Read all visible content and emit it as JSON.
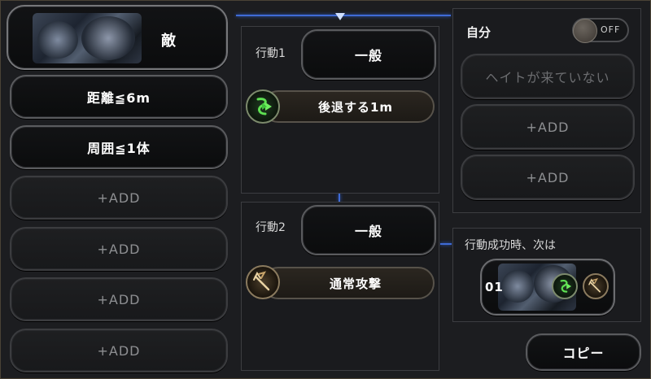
{
  "left_column": {
    "target_label": "敵",
    "conditions": [
      {
        "label": "距離≦6m",
        "state": "set"
      },
      {
        "label": "周囲≦1体",
        "state": "set"
      },
      {
        "label": "+ADD",
        "state": "add"
      },
      {
        "label": "+ADD",
        "state": "add"
      },
      {
        "label": "+ADD",
        "state": "add"
      },
      {
        "label": "+ADD",
        "state": "add"
      }
    ]
  },
  "actions": [
    {
      "label": "行動1",
      "type_label": "一般",
      "skill_label": "後退する1m",
      "skill_icon": "retreat-icon"
    },
    {
      "label": "行動2",
      "type_label": "一般",
      "skill_label": "通常攻撃",
      "skill_icon": "trident-icon"
    }
  ],
  "self_panel": {
    "label": "自分",
    "toggle_text": "OFF",
    "conditions": [
      {
        "label": "ヘイトが来ていない",
        "state": "disabled"
      },
      {
        "label": "+ADD",
        "state": "add"
      },
      {
        "label": "+ADD",
        "state": "add"
      }
    ]
  },
  "next_panel": {
    "label": "行動成功時、次は",
    "slot_number": "01"
  },
  "copy_button": "コピー",
  "colors": {
    "accent_blue": "#3f6bd6",
    "retreat_green": "#3fbf3a",
    "attack_gold": "#c8a46a"
  }
}
